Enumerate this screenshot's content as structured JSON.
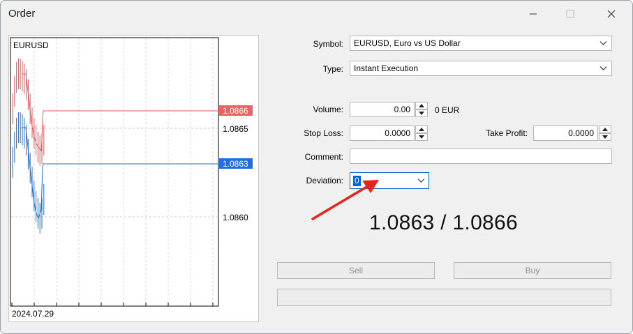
{
  "window": {
    "title": "Order"
  },
  "chart": {
    "symbol": "EURUSD",
    "date_label": "2024.07.29",
    "ask_badge": "1.0866",
    "bid_badge": "1.0863",
    "price_ticks": [
      "1.0865",
      "1.0860"
    ],
    "colors": {
      "ask": "#e8585a",
      "bid": "#1f6fd0",
      "bid_badge": "#1e6fe6",
      "ask_badge": "#ef6060"
    }
  },
  "form": {
    "symbol_label": "Symbol:",
    "symbol_value": "EURUSD, Euro vs US Dollar",
    "type_label": "Type:",
    "type_value": "Instant Execution",
    "volume_label": "Volume:",
    "volume_value": "0.00",
    "volume_unit": "0 EUR",
    "stop_loss_label": "Stop Loss:",
    "stop_loss_value": "0.0000",
    "take_profit_label": "Take Profit:",
    "take_profit_value": "0.0000",
    "comment_label": "Comment:",
    "comment_value": "",
    "deviation_label": "Deviation:",
    "deviation_value": "0"
  },
  "quote": {
    "text": "1.0863 / 1.0866"
  },
  "buttons": {
    "sell": "Sell",
    "buy": "Buy",
    "bottom": ""
  },
  "annotation": {
    "arrow_color": "#e8231e"
  }
}
